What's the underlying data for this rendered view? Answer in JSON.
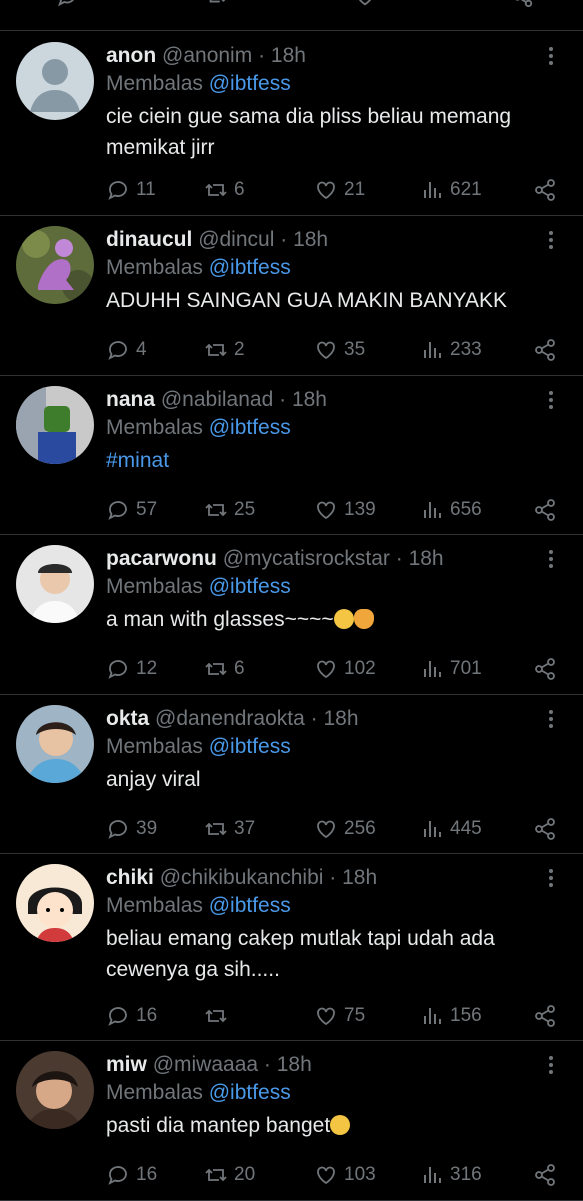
{
  "replying_to_label": "Membalas",
  "replying_to_handle": "@ibtfess",
  "tweets": [
    {
      "name": "anon",
      "handle": "@anonim",
      "time": "18h",
      "text": "cie ciein gue sama dia pliss beliau memang memikat jirr",
      "replies": "11",
      "retweets": "6",
      "likes": "21",
      "views": "621",
      "avatar": "default-avatar-icon"
    },
    {
      "name": "dinaucul",
      "handle": "@dincul",
      "time": "18h",
      "text": "ADUHH SAINGAN GUA MAKIN BANYAKK",
      "replies": "4",
      "retweets": "2",
      "likes": "35",
      "views": "233",
      "avatar": "purple-dinosaur-photo"
    },
    {
      "name": "nana",
      "handle": "@nabilanad",
      "time": "18h",
      "text": "#minat",
      "replies": "57",
      "retweets": "25",
      "likes": "139",
      "views": "656",
      "avatar": "lego-figure-photo"
    },
    {
      "name": "pacarwonu",
      "handle": "@mycatisrockstar",
      "time": "18h",
      "text": "a man with glasses~~~~",
      "text_emoji": "😌🫶",
      "replies": "12",
      "retweets": "6",
      "likes": "102",
      "views": "701",
      "avatar": "person-with-cap-photo"
    },
    {
      "name": "okta",
      "handle": "@danendraokta",
      "time": "18h",
      "text": "anjay viral",
      "replies": "39",
      "retweets": "37",
      "likes": "256",
      "views": "445",
      "avatar": "person-selfie-photo"
    },
    {
      "name": "chiki",
      "handle": "@chikibukanchibi",
      "time": "18h",
      "text": "beliau emang cakep mutlak tapi udah ada cewenya ga sih.....",
      "replies": "16",
      "retweets": "",
      "likes": "75",
      "views": "156",
      "avatar": "cartoon-girl-photo"
    },
    {
      "name": "miw",
      "handle": "@miwaaaa",
      "time": "18h",
      "text": "pasti dia mantep banget",
      "text_emoji": "😅",
      "replies": "16",
      "retweets": "20",
      "likes": "103",
      "views": "316",
      "avatar": "person-portrait-photo"
    }
  ],
  "colors": {
    "background": "#000000",
    "text": "#e7e9ea",
    "muted": "#71767b",
    "link": "#4a99e9",
    "divider": "#2f3336"
  }
}
